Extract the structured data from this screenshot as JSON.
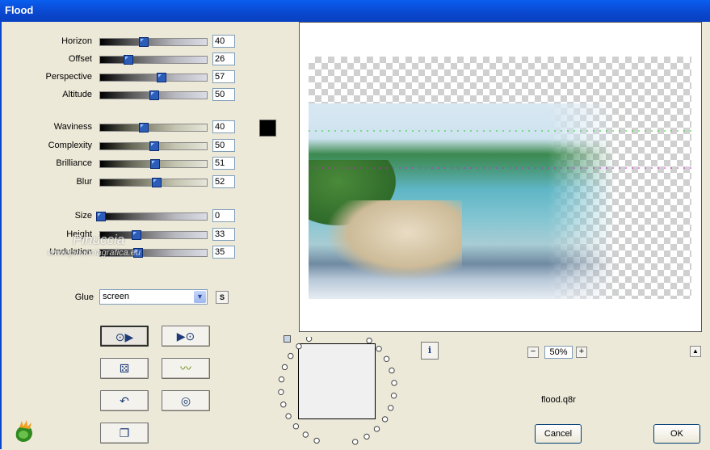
{
  "window": {
    "title": "Flood"
  },
  "sliders_group1": [
    {
      "label": "Horizon",
      "value": "40",
      "level": 0.4
    },
    {
      "label": "Offset",
      "value": "26",
      "level": 0.26
    },
    {
      "label": "Perspective",
      "value": "57",
      "level": 0.57
    },
    {
      "label": "Altitude",
      "value": "50",
      "level": 0.5
    }
  ],
  "sliders_group2": [
    {
      "label": "Waviness",
      "value": "40",
      "level": 0.4
    },
    {
      "label": "Complexity",
      "value": "50",
      "level": 0.5
    },
    {
      "label": "Brilliance",
      "value": "51",
      "level": 0.51
    },
    {
      "label": "Blur",
      "value": "52",
      "level": 0.52
    }
  ],
  "sliders_group3": [
    {
      "label": "Size",
      "value": "0",
      "level": 0.0
    },
    {
      "label": "Height",
      "value": "33",
      "level": 0.33
    },
    {
      "label": "Undulation",
      "value": "35",
      "level": 0.35
    }
  ],
  "color_swatch": "#000000",
  "glue": {
    "label": "Glue",
    "value": "screen",
    "s_label": "S"
  },
  "watermark": {
    "line1": "Pinuccia",
    "line2": "www.pinucciagrafica.eu"
  },
  "preview": {
    "zoom": "50%",
    "filename": "flood.q8r"
  },
  "buttons": {
    "cancel": "Cancel",
    "ok": "OK"
  },
  "colors": {
    "titlebar": "#0a48d0",
    "dialog_bg": "#ece9d8",
    "thumb": "#2c5db8"
  }
}
